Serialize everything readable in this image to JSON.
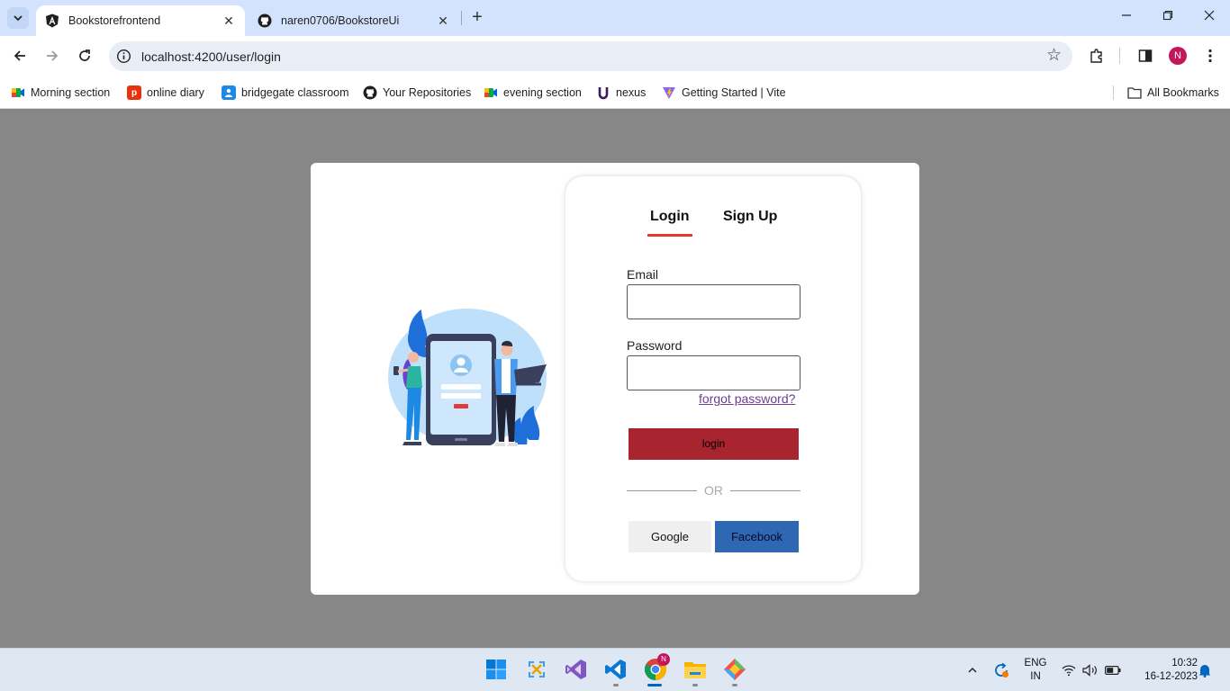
{
  "browser": {
    "tabs": [
      {
        "title": "Bookstorefrontend",
        "favicon": "angular-icon",
        "active": true
      },
      {
        "title": "naren0706/BookstoreUi",
        "favicon": "github-icon",
        "active": false
      }
    ],
    "url": "localhost:4200/user/login",
    "profile_initial": "N",
    "bookmarks": [
      {
        "label": "Morning section",
        "icon": "google-meet-icon"
      },
      {
        "label": "online diary",
        "icon": "pocket-icon"
      },
      {
        "label": "bridgegate classroom",
        "icon": "classroom-icon"
      },
      {
        "label": "Your Repositories",
        "icon": "github-icon"
      },
      {
        "label": "evening section",
        "icon": "google-meet-icon"
      },
      {
        "label": "nexus",
        "icon": "nexus-icon"
      },
      {
        "label": "Getting Started | Vite",
        "icon": "vite-icon"
      }
    ],
    "all_bookmarks": "All Bookmarks"
  },
  "login_form": {
    "tab_login": "Login",
    "tab_signup": "Sign Up",
    "email_label": "Email",
    "email_value": "",
    "password_label": "Password",
    "password_value": "",
    "forgot_password": "forgot password?",
    "login_button": "login",
    "or_text": "OR",
    "google_button": "Google",
    "facebook_button": "Facebook",
    "colors": {
      "login_button": "#a8242e",
      "facebook": "#2e67b2",
      "tab_underline": "#e53935"
    }
  },
  "taskbar": {
    "apps": [
      "windows-start-icon",
      "snipping-tool-icon",
      "visual-studio-icon",
      "vscode-icon",
      "chrome-icon",
      "file-explorer-icon",
      "git-icon"
    ],
    "chrome_badge": "N",
    "language_line1": "ENG",
    "language_line2": "IN",
    "time": "10:32",
    "date": "16-12-2023"
  }
}
